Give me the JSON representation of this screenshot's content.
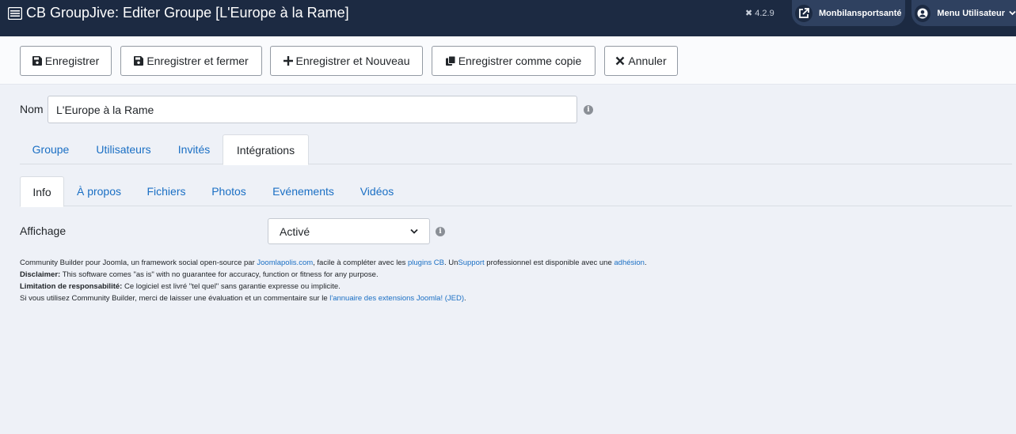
{
  "header": {
    "title": "CB GroupJive: Editer Groupe [L'Europe à la Rame]",
    "version": "4.2.9",
    "site_link": "Monbilansportsanté",
    "user_menu": "Menu Utilisateur"
  },
  "toolbar": {
    "save": "Enregistrer",
    "save_close": "Enregistrer et fermer",
    "save_new": "Enregistrer et Nouveau",
    "save_copy": "Enregistrer comme copie",
    "cancel": "Annuler"
  },
  "form": {
    "nom_label": "Nom",
    "nom_value": "L'Europe à la Rame",
    "affichage_label": "Affichage",
    "affichage_value": "Activé"
  },
  "tabs_main": [
    "Groupe",
    "Utilisateurs",
    "Invités",
    "Intégrations"
  ],
  "tabs_sub": [
    "Info",
    "À propos",
    "Fichiers",
    "Photos",
    "Evénements",
    "Vidéos"
  ],
  "footer": {
    "line1_a": "Community Builder pour Joomla, un framework social open-source par ",
    "line1_link1": "Joomlapolis.com",
    "line1_b": ", facile à compléter avec les ",
    "line1_link2": "plugins CB",
    "line1_c": ". Un",
    "line1_link3": "Support",
    "line1_d": " professionnel est disponible avec une ",
    "line1_link4": "adhésion",
    "line1_e": ".",
    "line2_bold": "Disclaimer:",
    "line2_text": " This software comes \"as is\" with no guarantee for accuracy, function or fitness for any purpose.",
    "line3_bold": "Limitation de responsabilité:",
    "line3_text": " Ce logiciel est livré \"tel quel\" sans garantie expresse ou implicite.",
    "line4_text": "Si vous utilisez Community Builder, merci de laisser une évaluation et un commentaire sur le ",
    "line4_link": "l'annuaire des extensions Joomla! (JED)",
    "line4_end": "."
  },
  "colors": {
    "header_bg": "#1c2a42",
    "link": "#1a6fc4",
    "page_bg": "#eef1f7"
  }
}
